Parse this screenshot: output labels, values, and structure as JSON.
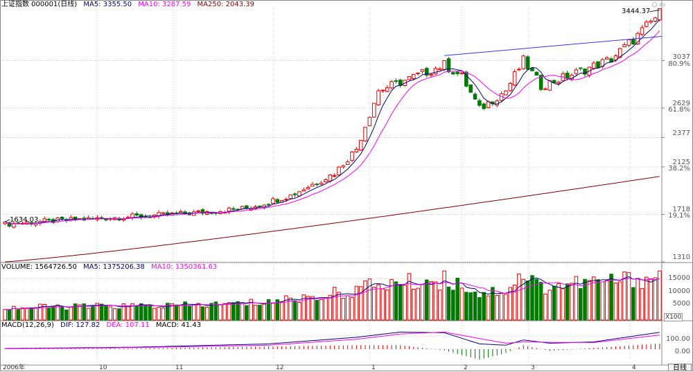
{
  "main_header": {
    "name": "上证指数 000001(日线)",
    "ma5_label": "MA5: 3355.50",
    "ma10_label": "MA10: 3287.59",
    "ma250_label": "MA250: 2043.39"
  },
  "volume_header": {
    "name": "VOLUME: 1564726.50",
    "ma5_label": "MA5: 1375206.38",
    "ma10_label": "MA10: 1350361.63"
  },
  "macd_header": {
    "name": "MACD(12,26,9)",
    "dif_label": "DIF: 127.82",
    "dea_label": "DEA: 107.11",
    "macd_label": "MACD: 41.43"
  },
  "price_axis": {
    "ticks": [
      "3037",
      "2629",
      "2377",
      "2125",
      "1718",
      "1310"
    ],
    "percent_ticks": [
      "80.9%",
      "61.8%",
      "38.2%",
      "19.1%"
    ]
  },
  "volume_axis": {
    "ticks": [
      "15000",
      "10000",
      "5000"
    ],
    "unit": "X100"
  },
  "macd_axis": {
    "ticks": [
      "100.00",
      "0.00"
    ]
  },
  "time_axis": {
    "labels": [
      "2006年",
      "10",
      "11",
      "12",
      "1",
      "2",
      "3",
      "4"
    ]
  },
  "annotations": {
    "high": "3444.37",
    "low": "1634.03"
  },
  "corner_icons": [
    "zoom-icon",
    "window-icon"
  ],
  "period_button": "日线",
  "colors": {
    "up": "#e60000",
    "down": "#007a00",
    "ma5": "#000080",
    "ma10": "#ff00ff",
    "ma250": "#800000",
    "trendline": "#3333ff",
    "grid": "#c8c8c8"
  },
  "chart_data": {
    "type": "candlestick",
    "price_range": [
      1310,
      3450
    ],
    "volume_range": [
      0,
      17500
    ],
    "bars": 150,
    "points": [
      {
        "i": 0,
        "close": 1634,
        "vol": 4300
      },
      {
        "i": 10,
        "close": 1660,
        "vol": 4700
      },
      {
        "i": 25,
        "close": 1690,
        "vol": 5000
      },
      {
        "i": 40,
        "close": 1720,
        "vol": 5200
      },
      {
        "i": 55,
        "close": 1770,
        "vol": 6000
      },
      {
        "i": 65,
        "close": 1880,
        "vol": 7500
      },
      {
        "i": 75,
        "close": 2070,
        "vol": 9500
      },
      {
        "i": 80,
        "close": 2280,
        "vol": 11000
      },
      {
        "i": 85,
        "close": 2780,
        "vol": 13000
      },
      {
        "i": 92,
        "close": 2880,
        "vol": 13500
      },
      {
        "i": 100,
        "close": 3000,
        "vol": 14500
      },
      {
        "i": 104,
        "close": 2900,
        "vol": 13000
      },
      {
        "i": 108,
        "close": 2620,
        "vol": 9500
      },
      {
        "i": 114,
        "close": 2780,
        "vol": 11000
      },
      {
        "i": 118,
        "close": 3035,
        "vol": 16500
      },
      {
        "i": 122,
        "close": 2820,
        "vol": 12000
      },
      {
        "i": 132,
        "close": 2960,
        "vol": 13500
      },
      {
        "i": 138,
        "close": 3050,
        "vol": 14000
      },
      {
        "i": 144,
        "close": 3250,
        "vol": 15000
      },
      {
        "i": 149,
        "close": 3444,
        "vol": 15600
      }
    ],
    "macd_points": [
      {
        "i": 0,
        "dif": 5,
        "dea": 3
      },
      {
        "i": 30,
        "dif": 15,
        "dea": 12
      },
      {
        "i": 60,
        "dif": 40,
        "dea": 30
      },
      {
        "i": 80,
        "dif": 90,
        "dea": 75
      },
      {
        "i": 90,
        "dif": 130,
        "dea": 115
      },
      {
        "i": 100,
        "dif": 125,
        "dea": 130
      },
      {
        "i": 108,
        "dif": 40,
        "dea": 80
      },
      {
        "i": 114,
        "dif": 30,
        "dea": 45
      },
      {
        "i": 118,
        "dif": 70,
        "dea": 55
      },
      {
        "i": 124,
        "dif": 45,
        "dea": 52
      },
      {
        "i": 134,
        "dif": 55,
        "dea": 50
      },
      {
        "i": 149,
        "dif": 128,
        "dea": 107
      }
    ],
    "ma250": {
      "start": 1310,
      "end": 2043
    }
  }
}
